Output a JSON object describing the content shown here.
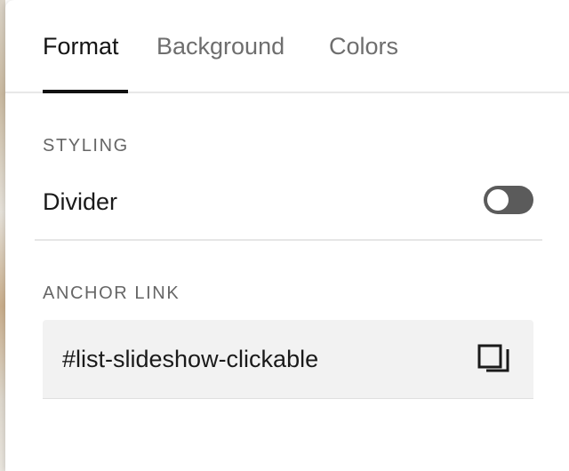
{
  "tabs": [
    {
      "label": "Format",
      "active": true
    },
    {
      "label": "Background",
      "active": false
    },
    {
      "label": "Colors",
      "active": false
    }
  ],
  "styling": {
    "section_label": "STYLING",
    "divider_label": "Divider",
    "divider_enabled": false
  },
  "anchor": {
    "section_label": "ANCHOR LINK",
    "value": "#list-slideshow-clickable",
    "copy_icon": "copy-icon"
  },
  "colors": {
    "active_text": "#141414",
    "inactive_text": "#6e6e6e",
    "toggle_track": "#5b5b5b",
    "field_background": "#f2f2f2"
  }
}
